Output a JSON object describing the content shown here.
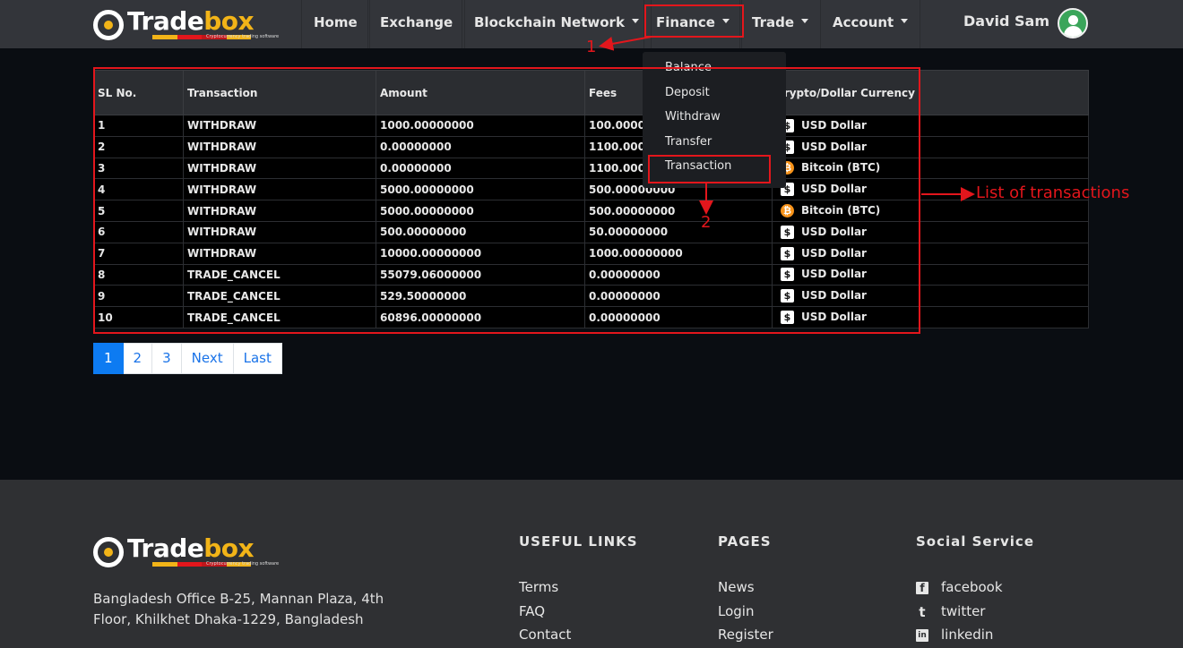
{
  "brand": {
    "name_part1": "Trade",
    "name_part2": "box",
    "tagline": "Cryptocurrency trading software",
    "strip_colors": [
      "#f2b418",
      "#e3161c",
      "#c0161b",
      "#f2b418"
    ]
  },
  "nav": {
    "home": "Home",
    "exchange": "Exchange",
    "blockchain": "Blockchain Network",
    "finance": "Finance",
    "trade": "Trade",
    "account": "Account",
    "user_name": "David Sam"
  },
  "dropdown": {
    "items": [
      "Balance",
      "Deposit",
      "Withdraw",
      "Transfer",
      "Transaction"
    ]
  },
  "table": {
    "headers": [
      "SL No.",
      "Transaction",
      "Amount",
      "Fees",
      "Crypto/Dollar Currency"
    ],
    "rows": [
      {
        "sl": "1",
        "type": "WITHDRAW",
        "amount": "1000.00000000",
        "fees": "100.00000000",
        "currency": "USD Dollar",
        "icon": "usd"
      },
      {
        "sl": "2",
        "type": "WITHDRAW",
        "amount": "0.00000000",
        "fees": "1100.00000000",
        "currency": "USD Dollar",
        "icon": "usd"
      },
      {
        "sl": "3",
        "type": "WITHDRAW",
        "amount": "0.00000000",
        "fees": "1100.00000000",
        "currency": "Bitcoin (BTC)",
        "icon": "btc"
      },
      {
        "sl": "4",
        "type": "WITHDRAW",
        "amount": "5000.00000000",
        "fees": "500.00000000",
        "currency": "USD Dollar",
        "icon": "usd"
      },
      {
        "sl": "5",
        "type": "WITHDRAW",
        "amount": "5000.00000000",
        "fees": "500.00000000",
        "currency": "Bitcoin (BTC)",
        "icon": "btc"
      },
      {
        "sl": "6",
        "type": "WITHDRAW",
        "amount": "500.00000000",
        "fees": "50.00000000",
        "currency": "USD Dollar",
        "icon": "usd"
      },
      {
        "sl": "7",
        "type": "WITHDRAW",
        "amount": "10000.00000000",
        "fees": "1000.00000000",
        "currency": "USD Dollar",
        "icon": "usd"
      },
      {
        "sl": "8",
        "type": "TRADE_CANCEL",
        "amount": "55079.06000000",
        "fees": "0.00000000",
        "currency": "USD Dollar",
        "icon": "usd"
      },
      {
        "sl": "9",
        "type": "TRADE_CANCEL",
        "amount": "529.50000000",
        "fees": "0.00000000",
        "currency": "USD Dollar",
        "icon": "usd"
      },
      {
        "sl": "10",
        "type": "TRADE_CANCEL",
        "amount": "60896.00000000",
        "fees": "0.00000000",
        "currency": "USD Dollar",
        "icon": "usd"
      }
    ]
  },
  "annotations": {
    "step1": "1",
    "step2": "2",
    "list_label": "List of transactions",
    "color": "#e3161c"
  },
  "pagination": {
    "pages": [
      "1",
      "2",
      "3"
    ],
    "active": "1",
    "next": "Next",
    "last": "Last"
  },
  "footer": {
    "address": "Bangladesh Office B-25, Mannan Plaza, 4th Floor, Khilkhet Dhaka-1229, Bangladesh",
    "useful_links_title": "USEFUL LINKS",
    "useful_links": [
      "Terms",
      "FAQ",
      "Contact"
    ],
    "pages_title": "PAGES",
    "pages": [
      "News",
      "Login",
      "Register"
    ],
    "social_title": "Social Service",
    "social": [
      {
        "label": "facebook",
        "icon": "facebook-icon"
      },
      {
        "label": "twitter",
        "icon": "twitter-icon"
      },
      {
        "label": "linkedin",
        "icon": "linkedin-icon"
      }
    ]
  }
}
